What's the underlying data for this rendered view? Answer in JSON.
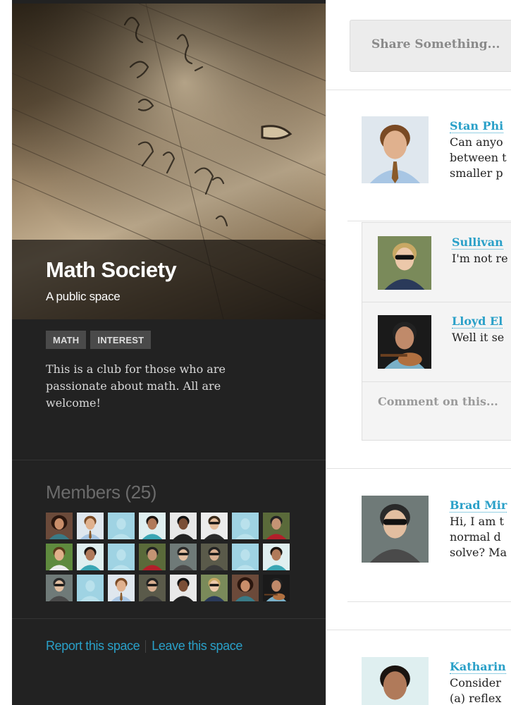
{
  "space": {
    "title": "Math Society",
    "subtitle": "A public space",
    "tags": [
      "MATH",
      "INTEREST"
    ],
    "description_lines": [
      "This is a club for those who are",
      "passionate about math. All are",
      "welcome!"
    ],
    "hero_image_icon": "whiteboard-photo"
  },
  "members": {
    "title": "Members (25)",
    "avatars": [
      "woman-curly",
      "man-suit",
      "placeholder",
      "woman-smile",
      "woman-dark",
      "man-glasses",
      "placeholder",
      "football-player",
      "man-beard",
      "woman-smile",
      "placeholder",
      "football-player",
      "man-sunglasses",
      "man-tattoo",
      "placeholder",
      "woman-smile",
      "man-sunglasses",
      "placeholder",
      "man-suit",
      "man-tattoo",
      "woman-dark",
      "man-blond",
      "woman-curly",
      "guitarist"
    ]
  },
  "footer": {
    "report_link": "Report this space",
    "leave_link": "Leave this space"
  },
  "feed": {
    "share_placeholder": "Share Something...",
    "posts": [
      {
        "author": "Stan Phi",
        "lines": [
          "Can anyo",
          "between t",
          "smaller p"
        ],
        "avatar_icon": "man-suit"
      },
      {
        "author": "Brad Mir",
        "lines": [
          "Hi, I am t",
          "normal d",
          "solve? Ma"
        ],
        "avatar_icon": "man-sunglasses"
      },
      {
        "author": "Katharin",
        "lines": [
          "Consider",
          "(a) reflex"
        ],
        "avatar_icon": "woman-smile"
      }
    ],
    "comments": [
      {
        "author": "Sullivan",
        "text": "I'm not re",
        "avatar_icon": "man-blond"
      },
      {
        "author": "Lloyd El",
        "text": "Well it se",
        "avatar_icon": "guitarist"
      }
    ],
    "comment_placeholder": "Comment on this..."
  },
  "colors": {
    "sidebar_bg": "#222222",
    "link": "#2aa0c8",
    "tag_bg": "#4a4a4a",
    "placeholder_avatar": "#9fd3e3"
  }
}
